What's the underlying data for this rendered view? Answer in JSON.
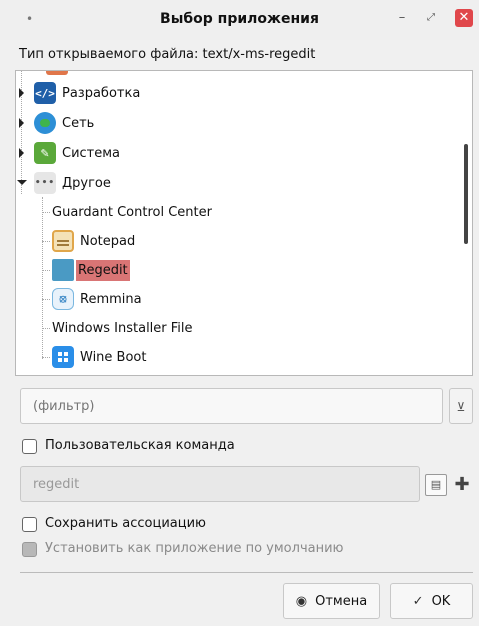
{
  "window": {
    "title": "Выбор приложения",
    "menu_icon": "dot-menu-icon",
    "minimize_glyph": "–",
    "maximize_glyph": "⤢",
    "close_glyph": "✕"
  },
  "file_type_label": "Тип открываемого файла: text/x-ms-regedit",
  "tree": {
    "categories": [
      {
        "label": "Разработка",
        "icon": "code-icon",
        "icon_glyph": "</>",
        "expanded": false
      },
      {
        "label": "Сеть",
        "icon": "globe-icon",
        "icon_glyph": "",
        "expanded": false
      },
      {
        "label": "Система",
        "icon": "wrench-icon",
        "icon_glyph": "✎",
        "expanded": false
      },
      {
        "label": "Другое",
        "icon": "more-icon",
        "icon_glyph": "•••",
        "expanded": true
      }
    ],
    "apps": [
      {
        "label": "Guardant Control Center",
        "icon": null
      },
      {
        "label": "Notepad",
        "icon": "notepad-icon"
      },
      {
        "label": "Regedit",
        "icon": "regedit-icon",
        "selected": true
      },
      {
        "label": "Remmina",
        "icon": "remmina-icon",
        "icon_glyph": "⦻"
      },
      {
        "label": "Windows Installer File",
        "icon": null
      },
      {
        "label": "Wine Boot",
        "icon": "windows-icon"
      }
    ]
  },
  "filter": {
    "placeholder": "(фильтр)",
    "clear_glyph": "⊻"
  },
  "custom_command": {
    "label": "Пользовательская команда",
    "checked": false,
    "value": "regedit",
    "browse_glyph": "▤",
    "add_glyph": "✚"
  },
  "remember_association": {
    "label": "Сохранить ассоциацию",
    "checked": false
  },
  "set_default": {
    "label": "Установить как приложение по умолчанию",
    "checked": false,
    "disabled": true
  },
  "buttons": {
    "cancel_label": "Отмена",
    "cancel_glyph": "◉",
    "ok_label": "OK",
    "ok_glyph": "✓"
  },
  "colors": {
    "selection": "#d97575",
    "close_button": "#e0474b"
  }
}
